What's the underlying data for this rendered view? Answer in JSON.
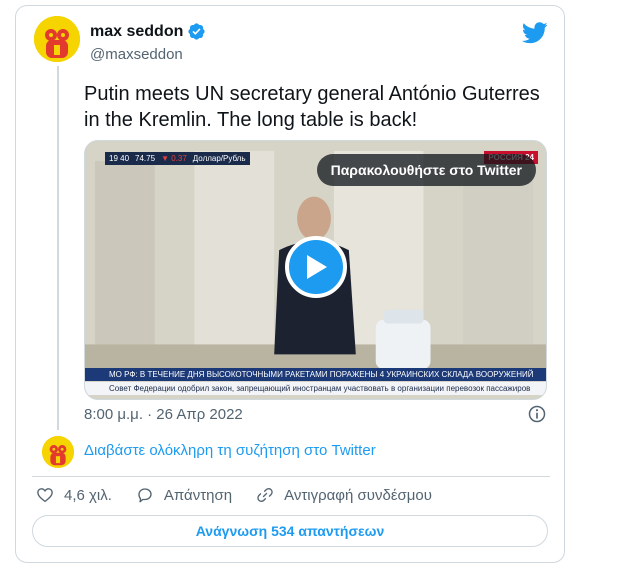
{
  "author": {
    "display_name": "max seddon",
    "handle": "@maxseddon",
    "verified": true
  },
  "icons": {
    "verified": "verified-badge-icon",
    "brand": "twitter-bird-icon",
    "info": "info-icon",
    "like": "heart-icon",
    "reply": "speech-bubble-icon",
    "copy_link": "link-icon",
    "play": "play-icon"
  },
  "tweet": {
    "text": "Putin meets UN secretary general António Guterres in the Kremlin. The long table is back!",
    "timestamp": "8:00 μ.μ. · 26 Απρ 2022"
  },
  "media": {
    "watch_label": "Παρακολουθήστε στο Twitter",
    "ticker_time": "19 40",
    "ticker_value": "74.75",
    "ticker_change": "▼ 0.37",
    "ticker_pair": "Доллар/Рубль",
    "channel": "РОССИЯ 24",
    "headline": "МО РФ: В ТЕЧЕНИЕ ДНЯ ВЫСОКОТОЧНЫМИ РАКЕТАМИ ПОРАЖЕНЫ 4 УКРАИНСКИХ СКЛАДА ВООРУЖЕНИЙ",
    "subline": "Совет Федерации одобрил закон, запрещающий иностранцам участвовать в организации перевозок пассажиров"
  },
  "thread": {
    "read_label": "Διαβάστε ολόκληρη τη συζήτηση στο Twitter"
  },
  "actions": {
    "like_count": "4,6 χιλ.",
    "reply_label": "Απάντηση",
    "copy_link_label": "Αντιγραφή συνδέσμου"
  },
  "replies_button_label": "Ανάγνωση 534 απαντήσεων",
  "colors": {
    "accent": "#1d9bf0",
    "text": "#0f1419",
    "muted": "#536471",
    "border": "#cfd9de",
    "avatar_bg": "#f5d400"
  }
}
